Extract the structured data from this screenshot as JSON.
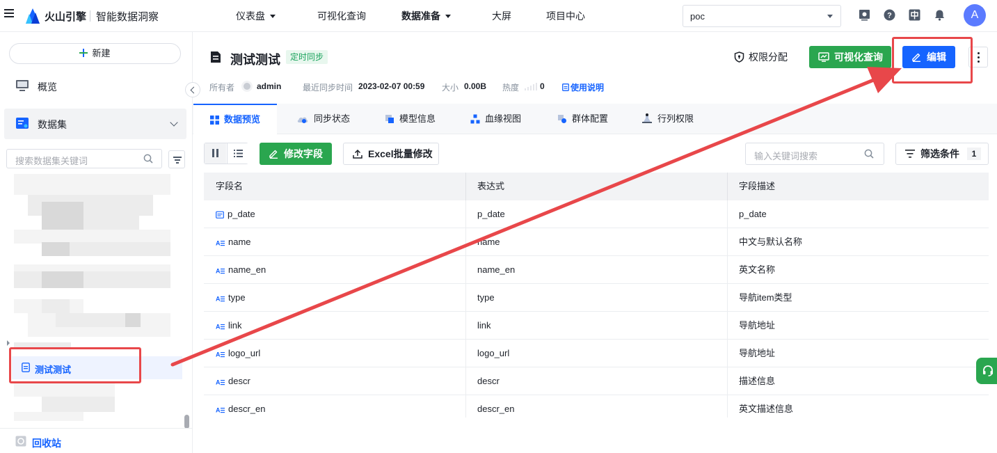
{
  "topbar": {
    "brand": "火山引擎",
    "product": "智能数据洞察",
    "nav": [
      {
        "label": "仪表盘",
        "dropdown": true,
        "bold": false
      },
      {
        "label": "可视化查询",
        "dropdown": false,
        "bold": false
      },
      {
        "label": "数据准备",
        "dropdown": true,
        "bold": true
      },
      {
        "label": "大屏",
        "dropdown": false,
        "bold": false
      },
      {
        "label": "项目中心",
        "dropdown": false,
        "bold": false
      }
    ],
    "project": "poc",
    "avatar_letter": "A"
  },
  "sidebar": {
    "new_label": "新建",
    "overview_label": "概览",
    "dataset_label": "数据集",
    "search_placeholder": "搜索数据集关键词",
    "selected_item": "测试测试",
    "recycle_label": "回收站"
  },
  "dataset": {
    "title": "测试测试",
    "sync_tag": "定时同步",
    "owner_label": "所有者",
    "owner": "admin",
    "last_sync_label": "最近同步时间",
    "last_sync": "2023-02-07 00:59",
    "size_label": "大小",
    "size": "0.00B",
    "heat_label": "热度",
    "heat": "0",
    "doc_link": "使用说明"
  },
  "actions": {
    "permission": "权限分配",
    "visual_query": "可视化查询",
    "edit": "编辑"
  },
  "tabs": [
    {
      "label": "数据预览",
      "active": true
    },
    {
      "label": "同步状态",
      "active": false
    },
    {
      "label": "模型信息",
      "active": false
    },
    {
      "label": "血缘视图",
      "active": false
    },
    {
      "label": "群体配置",
      "active": false
    },
    {
      "label": "行列权限",
      "active": false
    }
  ],
  "toolbar": {
    "modify_fields": "修改字段",
    "excel_batch": "Excel批量修改",
    "keyword_placeholder": "输入关键词搜索",
    "filter_label": "筛选条件",
    "filter_count": "1"
  },
  "table": {
    "headers": [
      "字段名",
      "表达式",
      "字段描述"
    ],
    "rows": [
      {
        "type": "date",
        "name": "p_date",
        "expr": "p_date",
        "desc": "p_date"
      },
      {
        "type": "text",
        "name": "name",
        "expr": "name",
        "desc": "中文与默认名称"
      },
      {
        "type": "text",
        "name": "name_en",
        "expr": "name_en",
        "desc": "英文名称"
      },
      {
        "type": "text",
        "name": "type",
        "expr": "type",
        "desc": "导航item类型"
      },
      {
        "type": "text",
        "name": "link",
        "expr": "link",
        "desc": "导航地址"
      },
      {
        "type": "text",
        "name": "logo_url",
        "expr": "logo_url",
        "desc": "导航地址"
      },
      {
        "type": "text",
        "name": "descr",
        "expr": "descr",
        "desc": "描述信息"
      },
      {
        "type": "text",
        "name": "descr_en",
        "expr": "descr_en",
        "desc": "英文描述信息"
      }
    ]
  },
  "colors": {
    "primary": "#1664ff",
    "green": "#2aa64f",
    "annotation": "#e8474a"
  }
}
